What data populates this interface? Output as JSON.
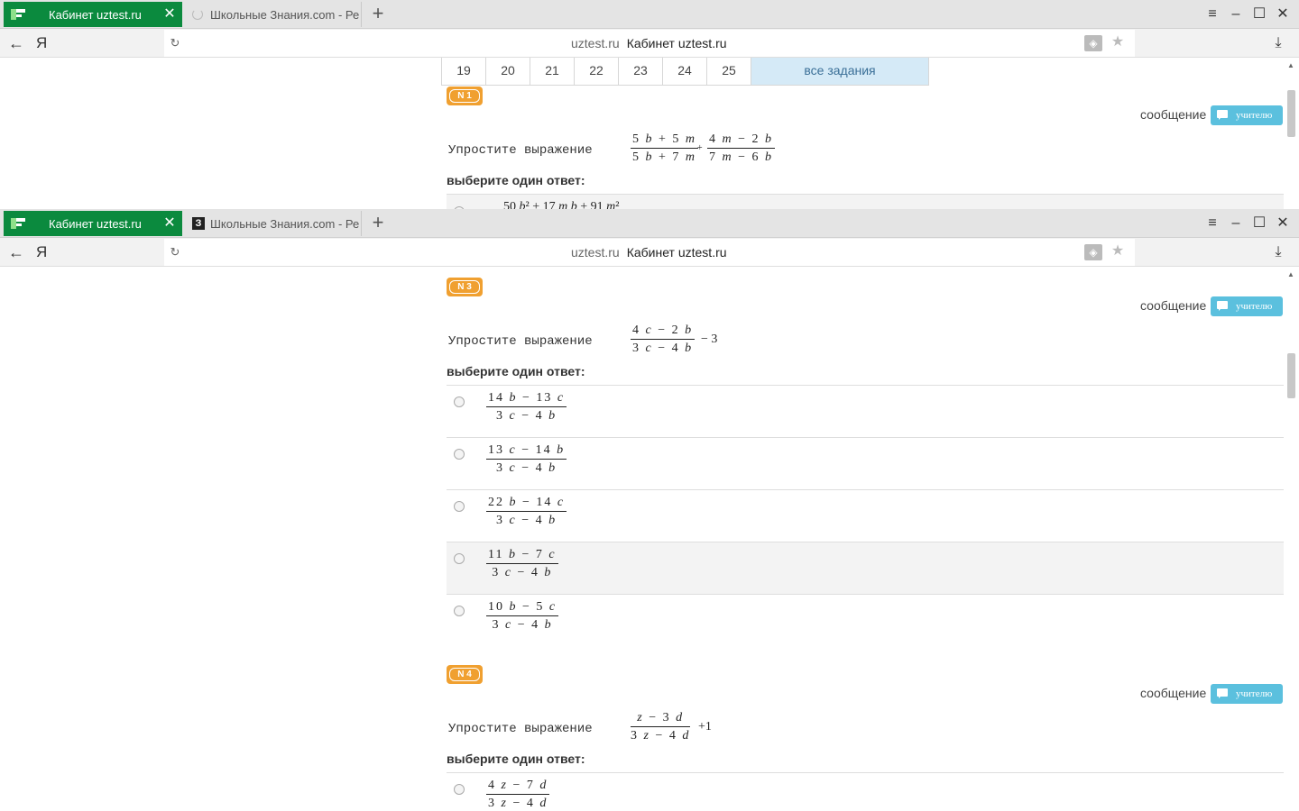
{
  "browser": {
    "tabs": {
      "active": {
        "title": "Кабинет uztest.ru"
      },
      "second": {
        "title": "Школьные Знания.com - Ре"
      },
      "second_icon": "З"
    },
    "address": {
      "domain": "uztest.ru",
      "page_title": "Кабинет uztest.ru"
    },
    "icons": {
      "back": "←",
      "yandex": "Я",
      "reload": "↻",
      "star": "★",
      "download": "⤓",
      "protect": "◈",
      "new_tab": "+",
      "menu": "≡",
      "minimize": "–",
      "maximize": "☐",
      "close": "✕",
      "tab_close": "✕"
    }
  },
  "window1": {
    "pager": {
      "pages": [
        "19",
        "20",
        "21",
        "22",
        "23",
        "24",
        "25"
      ],
      "all_label": "все задания"
    },
    "question": {
      "badge": "N 1",
      "message_label": "сообщение",
      "teacher_label": "учителю",
      "prompt": "Упростите выражение",
      "expr": {
        "f1_num": "5 b + 5 m",
        "f1_den": "5 b + 7 m",
        "op": "+",
        "f2_num": "4 m − 2 b",
        "f2_den": "7 m − 6 b"
      },
      "choose_label": "выберите один ответ:",
      "first_option_partial": "50 b² + 17 m b + 91 m²"
    }
  },
  "window2": {
    "q3": {
      "badge": "N 3",
      "message_label": "сообщение",
      "teacher_label": "учителю",
      "prompt": "Упростите выражение",
      "expr": {
        "num": "4 c − 2 b",
        "den": "3 c − 4 b",
        "op": "− 3"
      },
      "choose_label": "выберите один ответ:",
      "options": [
        {
          "num": "14 b − 13 c",
          "den": "3 c − 4 b"
        },
        {
          "num": "13 c − 14 b",
          "den": "3 c − 4 b"
        },
        {
          "num": "22 b − 14 c",
          "den": "3 c − 4 b"
        },
        {
          "num": "11 b − 7 c",
          "den": "3 c − 4 b"
        },
        {
          "num": "10 b − 5 c",
          "den": "3 c − 4 b"
        }
      ]
    },
    "q4": {
      "badge": "N 4",
      "message_label": "сообщение",
      "teacher_label": "учителю",
      "prompt": "Упростите выражение",
      "expr": {
        "num": "z − 3 d",
        "den": "3 z − 4 d",
        "op": "+1"
      },
      "choose_label": "выберите один ответ:",
      "options": [
        {
          "num": "4 z − 7 d",
          "den": "3 z − 4 d"
        }
      ]
    }
  },
  "colors": {
    "tab_active": "#0b8a3e",
    "badge": "#f0a030",
    "teacher_button": "#5bc0de",
    "pager_all": "#d5eaf7"
  }
}
